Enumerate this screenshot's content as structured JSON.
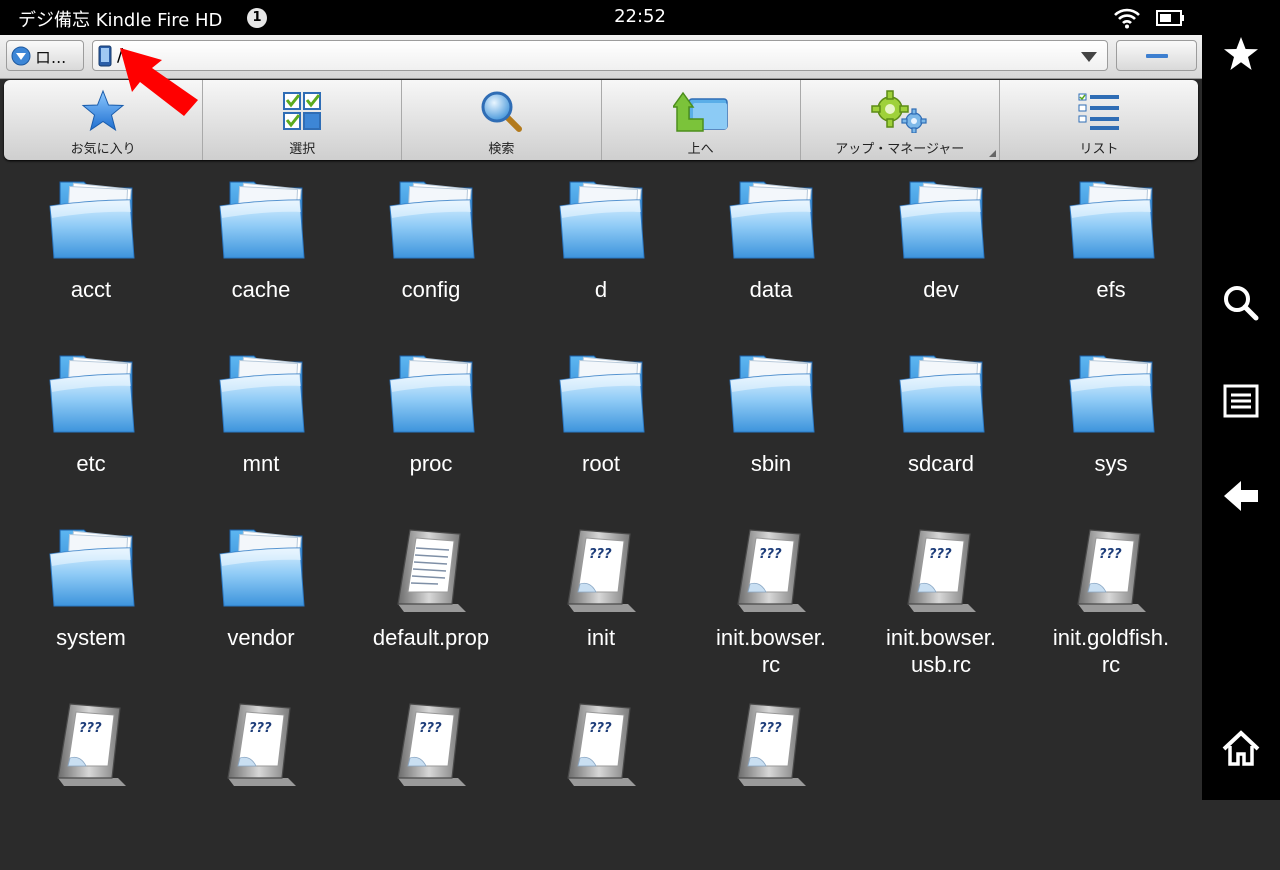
{
  "status_bar": {
    "title": "デジ備忘 Kindle Fire HD",
    "notification_count": "1",
    "time": "22:52",
    "icons": [
      "wifi-icon",
      "battery-icon"
    ]
  },
  "address_bar": {
    "location_button_label": "ロ...",
    "path": "/",
    "icons": [
      "device-icon",
      "dropdown-arrow-icon",
      "minus-icon"
    ]
  },
  "toolbar": {
    "buttons": [
      {
        "label": "お気に入り",
        "icon": "star-icon"
      },
      {
        "label": "選択",
        "icon": "checklist-icon"
      },
      {
        "label": "検索",
        "icon": "magnifier-icon"
      },
      {
        "label": "上へ",
        "icon": "up-folder-icon"
      },
      {
        "label": "アップ・マネージャー",
        "icon": "gears-icon"
      },
      {
        "label": "リスト",
        "icon": "list-icon"
      }
    ]
  },
  "files": [
    {
      "name": "acct",
      "type": "folder"
    },
    {
      "name": "cache",
      "type": "folder"
    },
    {
      "name": "config",
      "type": "folder"
    },
    {
      "name": "d",
      "type": "folder"
    },
    {
      "name": "data",
      "type": "folder"
    },
    {
      "name": "dev",
      "type": "folder"
    },
    {
      "name": "efs",
      "type": "folder"
    },
    {
      "name": "etc",
      "type": "folder"
    },
    {
      "name": "mnt",
      "type": "folder"
    },
    {
      "name": "proc",
      "type": "folder"
    },
    {
      "name": "root",
      "type": "folder"
    },
    {
      "name": "sbin",
      "type": "folder"
    },
    {
      "name": "sdcard",
      "type": "folder"
    },
    {
      "name": "sys",
      "type": "folder"
    },
    {
      "name": "system",
      "type": "folder"
    },
    {
      "name": "vendor",
      "type": "folder"
    },
    {
      "name": "default.prop",
      "type": "text-file"
    },
    {
      "name": "init",
      "type": "unknown-file"
    },
    {
      "name": "init.bowser.\nrc",
      "type": "unknown-file"
    },
    {
      "name": "init.bowser.\nusb.rc",
      "type": "unknown-file"
    },
    {
      "name": "init.goldfish.\nrc",
      "type": "unknown-file"
    },
    {
      "name": "",
      "type": "unknown-file"
    },
    {
      "name": "",
      "type": "unknown-file"
    },
    {
      "name": "",
      "type": "unknown-file"
    },
    {
      "name": "",
      "type": "unknown-file"
    },
    {
      "name": "",
      "type": "unknown-file"
    }
  ],
  "unknown_file_glyph": "???",
  "nav_bar": {
    "icons": [
      "favorites-star-icon",
      "search-icon",
      "menu-icon",
      "back-arrow-icon",
      "home-icon"
    ]
  },
  "colors": {
    "background": "#2b2b2b",
    "annotation_arrow": "#ff0000",
    "folder_blue": "#4aa3e8"
  }
}
